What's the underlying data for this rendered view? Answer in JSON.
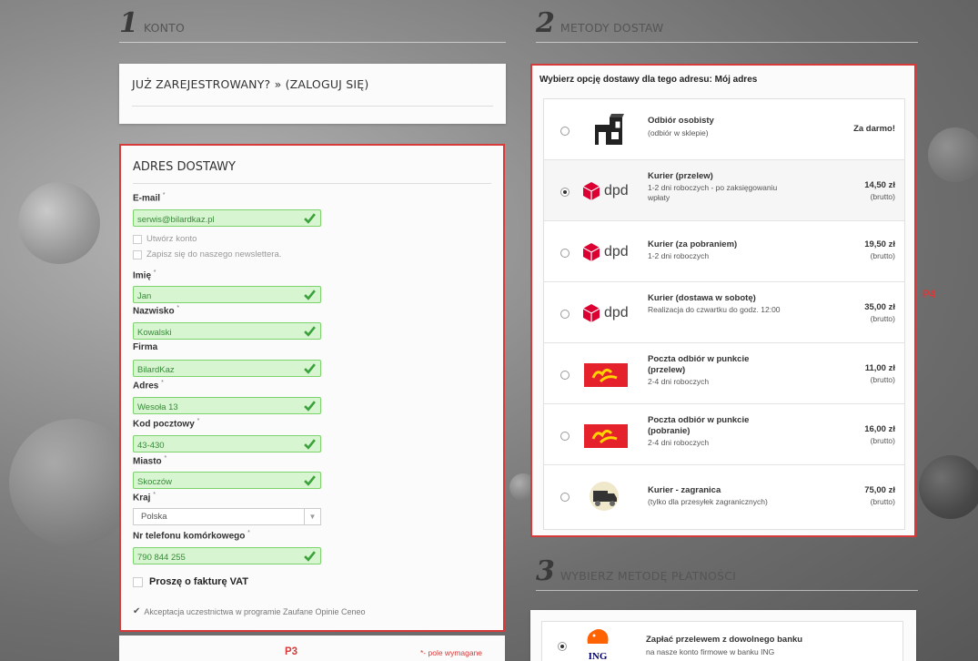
{
  "sections": {
    "konto": {
      "number": "1",
      "title": "KONTO"
    },
    "dostawa": {
      "number": "2",
      "title": "METODY DOSTAW"
    },
    "platnosc": {
      "number": "3",
      "title": "WYBIERZ METODĘ PŁATNOŚCI"
    }
  },
  "login": {
    "text": "JUŻ ZAREJESTROWANY? » (ZALOGUJ SIĘ)"
  },
  "address": {
    "title": "ADRES DOSTAWY",
    "required_mark": "*",
    "email": {
      "label": "E-mail",
      "value": "serwis@bilardkaz.pl"
    },
    "create_account": "Utwórz konto",
    "newsletter": "Zapisz się do naszego newslettera.",
    "first_name": {
      "label": "Imię",
      "value": "Jan"
    },
    "last_name": {
      "label": "Nazwisko",
      "value": "Kowalski"
    },
    "company": {
      "label": "Firma",
      "value": "BilardKaz"
    },
    "street": {
      "label": "Adres",
      "value": "Wesoła 13"
    },
    "postcode": {
      "label": "Kod pocztowy",
      "value": "43-430"
    },
    "city": {
      "label": "Miasto",
      "value": "Skoczów"
    },
    "country": {
      "label": "Kraj",
      "value": "Polska"
    },
    "phone": {
      "label": "Nr telefonu komórkowego",
      "value": "790 844 255"
    },
    "vat": "Proszę o fakturę VAT",
    "ceneo": "Akceptacja uczestnictwa w programie Zaufane Opinie Ceneo",
    "ceneo_check": "✔"
  },
  "annotations": {
    "p3": "P3",
    "p4": "P4"
  },
  "required_note": "*- pole wymagane",
  "shipping": {
    "heading": "Wybierz opcję dostawy dla tego adresu: Mój adres",
    "options": [
      {
        "name": "Odbiór osobisty",
        "desc": "(odbiór w sklepie)",
        "price": "Za darmo!",
        "brutto": "",
        "logo": "shop-icon",
        "selected": false
      },
      {
        "name": "Kurier (przelew)",
        "desc": "1-2 dni roboczych - po zaksięgowaniu wpłaty",
        "price": "14,50 zł",
        "brutto": "(brutto)",
        "logo": "dpd-logo",
        "selected": true
      },
      {
        "name": "Kurier (za pobraniem)",
        "desc": "1-2 dni roboczych",
        "price": "19,50 zł",
        "brutto": "(brutto)",
        "logo": "dpd-logo",
        "selected": false
      },
      {
        "name": "Kurier (dostawa w sobotę)",
        "desc": "Realizacja do czwartku do godz. 12:00",
        "price": "35,00 zł",
        "brutto": "(brutto)",
        "logo": "dpd-logo",
        "selected": false
      },
      {
        "name": "Poczta odbiór w punkcie",
        "name2": "(przelew)",
        "desc": "2-4 dni roboczych",
        "price": "11,00 zł",
        "brutto": "(brutto)",
        "logo": "poczta-logo",
        "selected": false
      },
      {
        "name": "Poczta odbiór w punkcie",
        "name2": "(pobranie)",
        "desc": "2-4 dni roboczych",
        "price": "16,00 zł",
        "brutto": "(brutto)",
        "logo": "poczta-logo",
        "selected": false
      },
      {
        "name": "Kurier - zagranica",
        "desc": "(tylko dla przesyłek zagranicznych)",
        "price": "75,00 zł",
        "brutto": "(brutto)",
        "logo": "truck-icon",
        "selected": false
      }
    ],
    "dpd_text": "dpd"
  },
  "payment": {
    "name": "Zapłać przelewem z dowolnego banku",
    "desc": "na nasze konto firmowe w banku ING",
    "ing_text": "ING"
  },
  "colors": {
    "accent_red": "#d63a3a",
    "valid_green": "#7cd36b",
    "valid_bg": "#d6f5d0",
    "dpd_red": "#dc0032",
    "poczta_red": "#e5222b",
    "poczta_yellow": "#ffd400"
  }
}
